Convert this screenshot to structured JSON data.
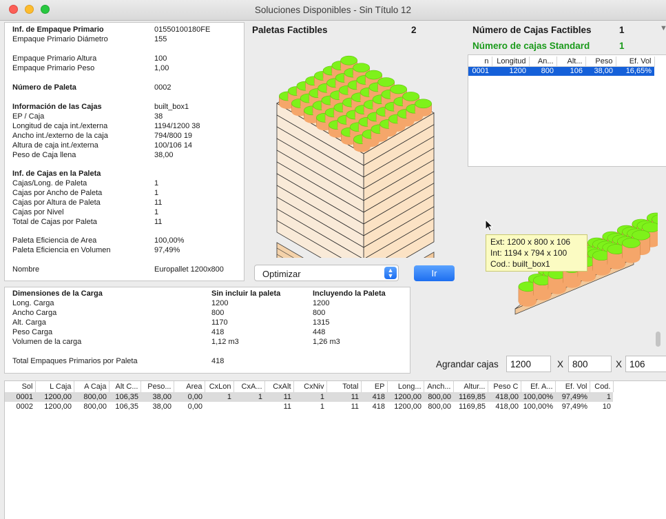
{
  "window": {
    "title": "Soluciones Disponibles - Sin Título 12"
  },
  "info": {
    "emp_primario_title": "Inf. de Empaque Primario",
    "emp_primario_code": "01550100180FE",
    "diametro_label": "Empaque Primario Diámetro",
    "diametro_value": "155",
    "altura_label": "Empaque Primario Altura",
    "altura_value": "100",
    "peso_label": "Empaque Primario Peso",
    "peso_value": "1,00",
    "num_paleta_label": "Número de Paleta",
    "num_paleta_value": "0002",
    "cajas_title": "Información de las Cajas",
    "cajas_name": "built_box1",
    "ep_caja_label": "EP / Caja",
    "ep_caja_value": "38",
    "longitud_label": "Longitud de caja int./externa",
    "longitud_value": "1194/1200  38",
    "ancho_label": "Ancho int./externo de la caja",
    "ancho_value": "794/800  19",
    "altura_caja_label": "Altura de caja int./externa",
    "altura_caja_value": "100/106  14",
    "peso_caja_label": "Peso de Caja llena",
    "peso_caja_value": "38,00",
    "paleta_title": "Inf. de Cajas en la Paleta",
    "long_paleta_label": "Cajas/Long. de Paleta",
    "long_paleta_value": "1",
    "ancho_paleta_label": "Cajas por Ancho de Paleta",
    "ancho_paleta_value": "1",
    "altura_paleta_label": "Cajas por Altura de Paleta",
    "altura_paleta_value": "11",
    "nivel_label": "Cajas por Nivel",
    "nivel_value": "1",
    "total_label": "Total de Cajas por Paleta",
    "total_value": "11",
    "ef_area_label": "Paleta Eficiencia de Area",
    "ef_area_value": "100,00%",
    "ef_vol_label": "Paleta Eficiencia en Volumen",
    "ef_vol_value": "97,49%",
    "nombre_label": "Nombre",
    "nombre_value": "Europallet 1200x800"
  },
  "dims": {
    "title": "Dimensiones de la Carga",
    "col1": "Sin incluir la paleta",
    "col2": "Incluyendo la Paleta",
    "rows": [
      {
        "label": "Long. Carga",
        "v1": "1200",
        "v2": "1200"
      },
      {
        "label": "Ancho Carga",
        "v1": "800",
        "v2": "800"
      },
      {
        "label": "Alt. Carga",
        "v1": "1170",
        "v2": "1315"
      },
      {
        "label": "Peso Carga",
        "v1": "418",
        "v2": "448"
      },
      {
        "label": "Volumen de la carga",
        "v1": "1,12 m3",
        "v2": "1,26 m3"
      }
    ],
    "total_label": "Total Empaques Primarios por Paleta",
    "total_value": "418"
  },
  "paletas": {
    "title": "Paletas Factibles",
    "count": "2"
  },
  "cajas_factibles": {
    "title": "Número de Cajas Factibles",
    "count": "1",
    "standard_title": "Número de cajas Standard",
    "standard_count": "1",
    "standard_color": "#1a9a1a",
    "columns": [
      "n",
      "Longitud",
      "An...",
      "Alt...",
      "Peso",
      "Ef. Vol"
    ],
    "rows": [
      [
        "0001",
        "1200",
        "800",
        "106",
        "38,00",
        "16,65%"
      ]
    ]
  },
  "controls": {
    "optimizar": "Optimizar",
    "ir": "Ir",
    "agrandar": "Agrandar cajas",
    "x_sep": "X",
    "grow_l": "1200",
    "grow_w": "800",
    "grow_h": "106"
  },
  "tooltip": {
    "ext": "Ext: 1200 x 800 x 106",
    "int": "Int: 1194 x 794 x 100",
    "cod": "Cod.: built_box1"
  },
  "results": {
    "columns": [
      "Sol",
      "L Caja",
      "A Caja",
      "Alt C...",
      "Peso...",
      "Area",
      "CxLon",
      "CxA...",
      "CxAlt",
      "CxNiv",
      "Total",
      "EP",
      "Long...",
      "Anch...",
      "Altur...",
      "Peso C",
      "Ef. A...",
      "Ef. Vol",
      "Cod."
    ],
    "rows": [
      [
        "0001",
        "1200,00",
        "800,00",
        "106,35",
        "38,00",
        "0,00",
        "1",
        "1",
        "11",
        "1",
        "11",
        "418",
        "1200,00",
        "800,00",
        "1169,85",
        "418,00",
        "100,00%",
        "97,49%",
        "1"
      ],
      [
        "0002",
        "1200,00",
        "800,00",
        "106,35",
        "38,00",
        "0,00",
        "",
        "",
        "11",
        "1",
        "11",
        "418",
        "1200,00",
        "800,00",
        "1169,85",
        "418,00",
        "100,00%",
        "97,49%",
        "10"
      ]
    ]
  },
  "colors": {
    "accent": "#1560d9",
    "lime": "#7ef21a",
    "box": "#f5a66a",
    "tooltip": "#fbfbc2"
  },
  "icons": {
    "chevron": "chevron-updown-icon",
    "cursor": "mouse-pointer-icon",
    "dropdown": "triangle-down-icon"
  }
}
